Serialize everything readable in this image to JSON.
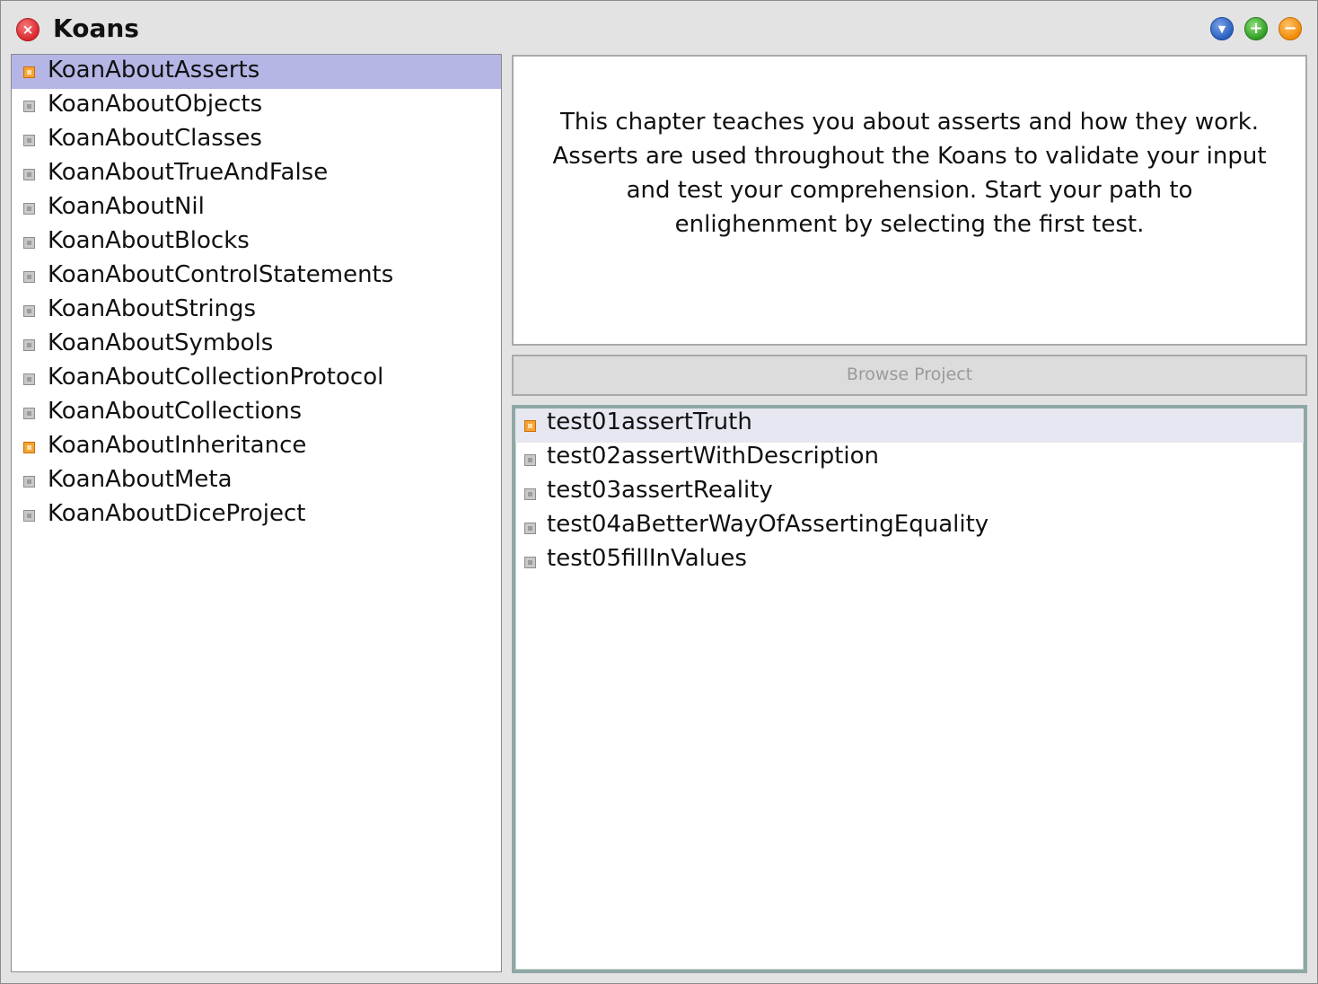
{
  "window": {
    "title": "Koans",
    "close_glyph": "×",
    "menu_glyph": "▼",
    "expand_glyph": "+",
    "collapse_glyph": "−"
  },
  "koans": [
    {
      "label": "KoanAboutAsserts",
      "status": "pending",
      "selected": true
    },
    {
      "label": "KoanAboutObjects",
      "status": "neutral"
    },
    {
      "label": "KoanAboutClasses",
      "status": "neutral"
    },
    {
      "label": "KoanAboutTrueAndFalse",
      "status": "neutral"
    },
    {
      "label": "KoanAboutNil",
      "status": "neutral"
    },
    {
      "label": "KoanAboutBlocks",
      "status": "neutral"
    },
    {
      "label": "KoanAboutControlStatements",
      "status": "neutral"
    },
    {
      "label": "KoanAboutStrings",
      "status": "neutral"
    },
    {
      "label": "KoanAboutSymbols",
      "status": "neutral"
    },
    {
      "label": "KoanAboutCollectionProtocol",
      "status": "neutral"
    },
    {
      "label": "KoanAboutCollections",
      "status": "neutral"
    },
    {
      "label": "KoanAboutInheritance",
      "status": "pending"
    },
    {
      "label": "KoanAboutMeta",
      "status": "neutral"
    },
    {
      "label": "KoanAboutDiceProject",
      "status": "neutral"
    }
  ],
  "description": "This chapter teaches you about asserts and how they work. Asserts are used throughout the Koans to validate your input and test your comprehension. Start your path to enlighenment by selecting the first test.",
  "browse_button": "Browse Project",
  "tests": [
    {
      "label": "test01assertTruth",
      "status": "pending",
      "selected": true
    },
    {
      "label": "test02assertWithDescription",
      "status": "neutral"
    },
    {
      "label": "test03assertReality",
      "status": "neutral"
    },
    {
      "label": "test04aBetterWayOfAssertingEquality",
      "status": "neutral"
    },
    {
      "label": "test05fillInValues",
      "status": "neutral"
    }
  ],
  "colors": {
    "selection": "#b5b6e6",
    "pending_marker": "#f7a335",
    "close_button": "#d9272d",
    "menu_button": "#2a5fc0",
    "expand_button": "#2f9d24",
    "collapse_button": "#f08a06"
  },
  "icons": {
    "close": "close-icon",
    "menu": "menu-icon",
    "expand": "expand-icon",
    "collapse": "collapse-icon",
    "status_marker": "status-marker-icon"
  }
}
